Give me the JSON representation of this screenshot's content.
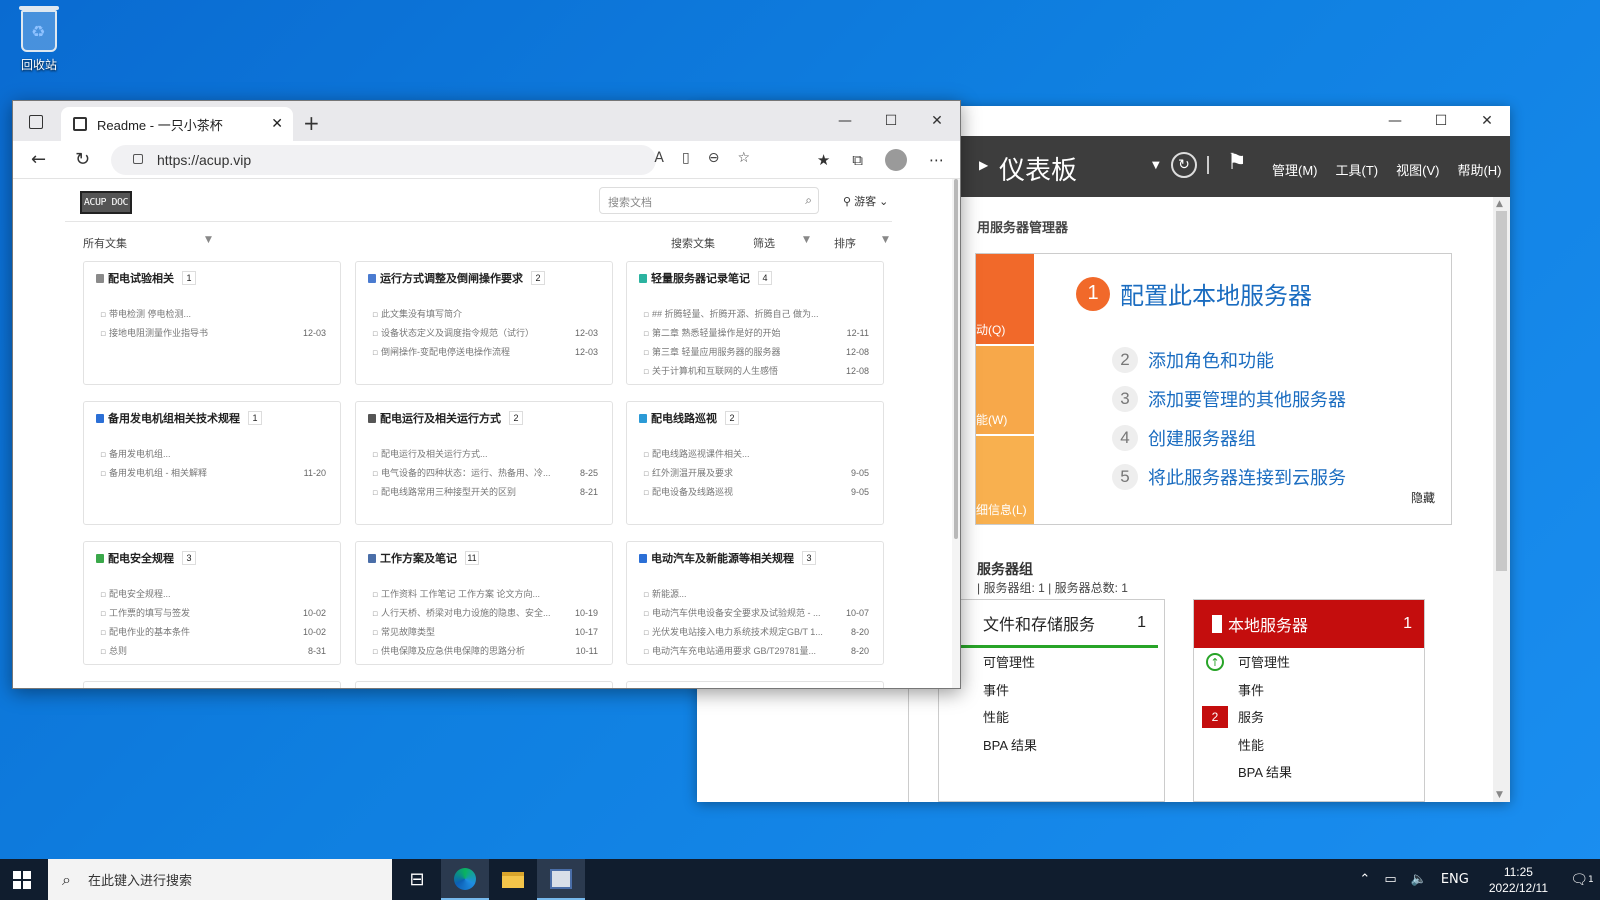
{
  "desktop": {
    "recycle_bin_label": "回收站"
  },
  "server_manager": {
    "window_controls": [
      "—",
      "☐",
      "✕"
    ],
    "title": "仪表板",
    "menu": [
      "管理(M)",
      "工具(T)",
      "视图(V)",
      "帮助(H)"
    ],
    "welcome": "用服务器管理器",
    "tiles": [
      "动(Q)",
      "能(W)",
      "细信息(L)"
    ],
    "quickstart": {
      "main_number": "1",
      "main_label": "配置此本地服务器",
      "items": [
        {
          "num": "2",
          "label": "添加角色和功能"
        },
        {
          "num": "3",
          "label": "添加要管理的其他服务器"
        },
        {
          "num": "4",
          "label": "创建服务器组"
        },
        {
          "num": "5",
          "label": "将此服务器连接到云服务"
        }
      ],
      "hide": "隐藏"
    },
    "roles_title": "服务器组",
    "roles_subtitle": "| 服务器组: 1 | 服务器总数: 1",
    "card_file": {
      "title": "文件和存储服务",
      "count": "1",
      "rows": [
        "可管理性",
        "事件",
        "性能",
        "BPA 结果"
      ]
    },
    "card_local": {
      "title": "本地服务器",
      "count": "1",
      "rows": [
        "可管理性",
        "事件",
        "服务",
        "性能",
        "BPA 结果"
      ],
      "services_badge": "2"
    },
    "accent_color": "#c40d0d"
  },
  "edge": {
    "tab_title": "Readme - 一只小茶杯",
    "url": "https://acup.vip",
    "window_controls": [
      "—",
      "☐",
      "✕"
    ]
  },
  "site": {
    "logo": "ACUP DOC",
    "search_placeholder": "搜索文档",
    "user": "游客",
    "all_docs": "所有文集",
    "search_collections": "搜索文集",
    "filter": "筛选",
    "sort": "排序",
    "collections": [
      {
        "title": "配电试验相关",
        "count": "1",
        "color": "#8a8a8a",
        "lines": [
          {
            "t": "带电检测 停电检测...",
            "d": ""
          },
          {
            "t": "接地电阻测量作业指导书",
            "d": "12-03"
          }
        ]
      },
      {
        "title": "运行方式调整及倒闸操作要求",
        "count": "2",
        "color": "#4a7bd0",
        "lines": [
          {
            "t": "此文集没有填写简介",
            "d": ""
          },
          {
            "t": "设备状态定义及调度指令规范（试行）",
            "d": "12-03"
          },
          {
            "t": "倒闸操作-变配电停送电操作流程",
            "d": "12-03"
          }
        ]
      },
      {
        "title": "轻量服务器记录笔记",
        "count": "4",
        "color": "#2bb3a0",
        "lines": [
          {
            "t": "## 折腾轻量、折腾开源、折腾自己 做为...",
            "d": ""
          },
          {
            "t": "第二章 熟悉轻量操作是好的开始",
            "d": "12-11"
          },
          {
            "t": "第三章 轻量应用服务器的服务器",
            "d": "12-08"
          },
          {
            "t": "关于计算机和互联网的人生感悟",
            "d": "12-08"
          }
        ]
      },
      {
        "title": "备用发电机组相关技术规程",
        "count": "1",
        "color": "#2b6fd6",
        "lines": [
          {
            "t": "备用发电机组...",
            "d": ""
          },
          {
            "t": "备用发电机组 - 相关解释",
            "d": "11-20"
          }
        ]
      },
      {
        "title": "配电运行及相关运行方式",
        "count": "2",
        "color": "#555555",
        "lines": [
          {
            "t": "配电运行及相关运行方式...",
            "d": ""
          },
          {
            "t": "电气设备的四种状态：运行、热备用、冷...",
            "d": "8-25"
          },
          {
            "t": "配电线路常用三种接型开关的区别",
            "d": "8-21"
          }
        ]
      },
      {
        "title": "配电线路巡视",
        "count": "2",
        "color": "#2b9ad6",
        "lines": [
          {
            "t": "配电线路巡视课件相关...",
            "d": ""
          },
          {
            "t": "红外测温开展及要求",
            "d": "9-05"
          },
          {
            "t": "配电设备及线路巡视",
            "d": "9-05"
          }
        ]
      },
      {
        "title": "配电安全规程",
        "count": "3",
        "color": "#3aa84a",
        "lines": [
          {
            "t": "配电安全规程...",
            "d": ""
          },
          {
            "t": "工作票的填写与签发",
            "d": "10-02"
          },
          {
            "t": "配电作业的基本条件",
            "d": "10-02"
          },
          {
            "t": "总则",
            "d": "8-31"
          }
        ]
      },
      {
        "title": "工作方案及笔记",
        "count": "11",
        "color": "#4a6ea8",
        "lines": [
          {
            "t": "工作资料 工作笔记 工作方案 论文方向...",
            "d": ""
          },
          {
            "t": "人行天桥、桥梁对电力设施的隐患、安全...",
            "d": "10-19"
          },
          {
            "t": "常见故障类型",
            "d": "10-17"
          },
          {
            "t": "供电保障及应急供电保障的思路分析",
            "d": "10-11"
          }
        ]
      },
      {
        "title": "电动汽车及新能源等相关规程",
        "count": "3",
        "color": "#2b6fd6",
        "lines": [
          {
            "t": "新能源...",
            "d": ""
          },
          {
            "t": "电动汽车供电设备安全要求及试验规范 - ...",
            "d": "10-07"
          },
          {
            "t": "光伏发电站接入电力系统技术规定GB/T 1...",
            "d": "8-20"
          },
          {
            "t": "电动汽车充电站通用要求 GB/T29781量...",
            "d": "8-20"
          }
        ]
      }
    ]
  },
  "taskbar": {
    "search_placeholder": "在此键入进行搜索",
    "lang": "ENG",
    "time": "11:25",
    "date": "2022/12/11",
    "notification_count": "1"
  }
}
